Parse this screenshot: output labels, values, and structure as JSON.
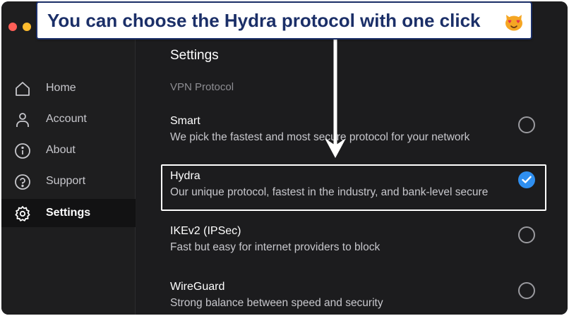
{
  "banner": {
    "text": "You can choose the Hydra protocol with one click",
    "emoji": "heart-eyes-cat-emoji"
  },
  "sidebar": {
    "items": [
      {
        "label": "Home",
        "icon": "home-icon",
        "active": false
      },
      {
        "label": "Account",
        "icon": "account-icon",
        "active": false
      },
      {
        "label": "About",
        "icon": "info-icon",
        "active": false
      },
      {
        "label": "Support",
        "icon": "help-icon",
        "active": false
      },
      {
        "label": "Settings",
        "icon": "gear-icon",
        "active": true
      }
    ]
  },
  "main": {
    "title": "Settings",
    "section_label": "VPN Protocol",
    "options": [
      {
        "name": "Smart",
        "description": "We pick the fastest and most secure protocol for your network",
        "selected": false
      },
      {
        "name": "Hydra",
        "description": "Our unique protocol, fastest in the industry, and bank-level secure",
        "selected": true
      },
      {
        "name": "IKEv2 (IPSec)",
        "description": "Fast but easy for internet providers to block",
        "selected": false
      },
      {
        "name": "WireGuard",
        "description": "Strong balance between speed and security",
        "selected": false
      }
    ]
  },
  "colors": {
    "accent": "#2f8ff0",
    "banner_text": "#1b2f68",
    "background": "#1c1c1e"
  }
}
